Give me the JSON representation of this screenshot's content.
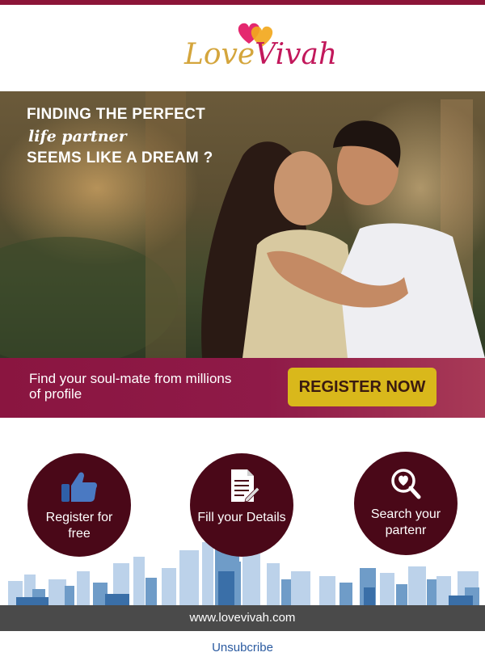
{
  "brand": {
    "logo_part1": "Love",
    "logo_part2": "Vivah",
    "color_primary": "#8c1538",
    "color_accent": "#d9b81b",
    "logo_icon": "hearts-icon"
  },
  "hero": {
    "line1": "FINDING THE PERFECT",
    "line2": "life partner",
    "line3": "SEEMS LIKE A DREAM ?"
  },
  "cta": {
    "text": "Find your soul-mate from millions of profile",
    "button_label": "REGISTER NOW"
  },
  "steps": [
    {
      "icon": "thumbs-up-icon",
      "label": "Register for free"
    },
    {
      "icon": "document-icon",
      "label": "Fill your Details"
    },
    {
      "icon": "search-heart-icon",
      "label": "Search your partenr"
    }
  ],
  "footer": {
    "website": "www.lovevivah.com",
    "unsubscribe": "Unsubcribe"
  }
}
